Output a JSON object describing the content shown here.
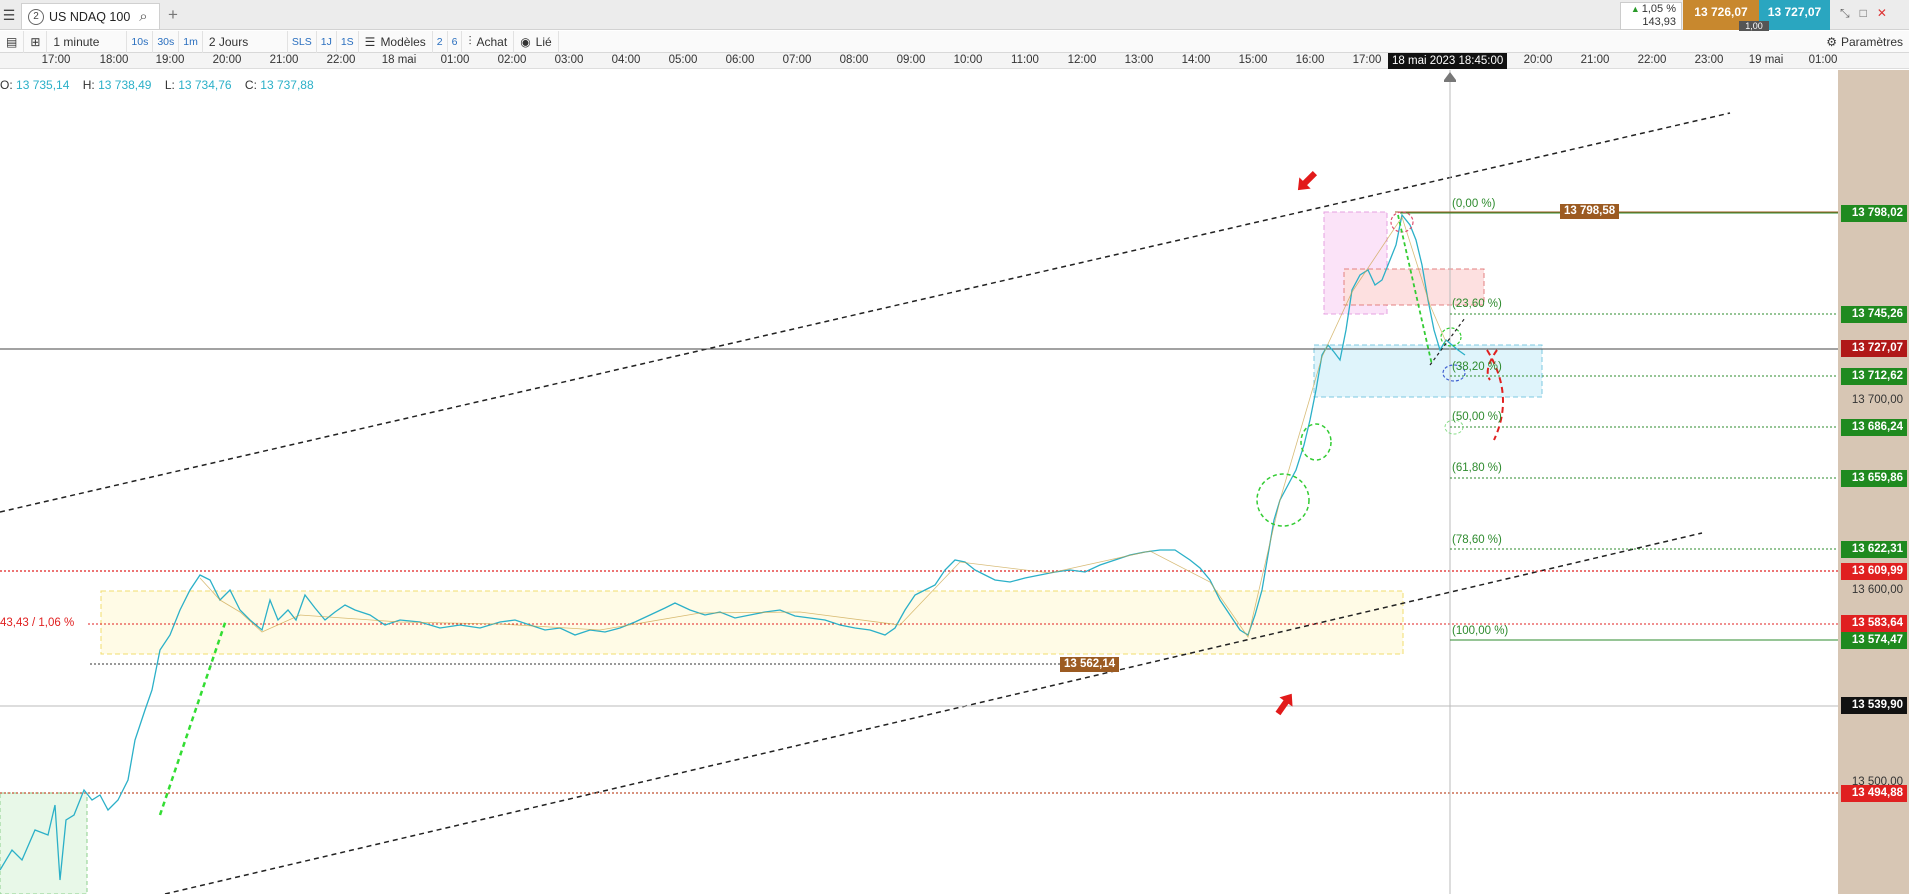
{
  "topbar": {
    "instrument_num": "2",
    "instrument_name": "US NDAQ 100",
    "change_pct": "1,05 %",
    "change_abs": "143,93",
    "bid": "13 726,07",
    "ask": "13 727,07",
    "spread": "1,00"
  },
  "toolbar": {
    "timeframe": "1 minute",
    "quick_frames": [
      "10s",
      "30s",
      "1m"
    ],
    "period": "2 Jours",
    "quick_flags": [
      "SLS",
      "1J",
      "1S"
    ],
    "models_label": "Modèles",
    "model_nums": [
      "2",
      "6"
    ],
    "buy_label": "Achat",
    "linked_label": "Lié",
    "settings_label": "Paramètres"
  },
  "time_axis": {
    "labels": [
      "17:00",
      "18:00",
      "19:00",
      "20:00",
      "21:00",
      "22:00",
      "18 mai",
      "01:00",
      "02:00",
      "03:00",
      "04:00",
      "05:00",
      "06:00",
      "07:00",
      "08:00",
      "09:00",
      "10:00",
      "11:00",
      "12:00",
      "13:00",
      "14:00",
      "15:00",
      "16:00",
      "17:00",
      "20:00",
      "21:00",
      "22:00",
      "23:00",
      "19 mai",
      "01:00"
    ],
    "crosshair_label": "18 mai 2023 18:45:00"
  },
  "ohlc": {
    "o_label": "O:",
    "o": "13 735,14",
    "h_label": "H:",
    "h": "13 738,49",
    "l_label": "L:",
    "l": "13 734,76",
    "c_label": "C:",
    "c": "13 737,88"
  },
  "price_labels": {
    "p1": "13 798,02",
    "p2": "13 745,26",
    "current": "13 727,07",
    "p3": "13 712,62",
    "p4": "13 686,24",
    "p5": "13 659,86",
    "p6": "13 622,31",
    "red1": "13 609,99",
    "red2": "13 583,64",
    "p7": "13 574,47",
    "crosshair_price": "13 539,90",
    "red3": "13 494,88"
  },
  "price_scale_ticks": [
    "13 700,00",
    "13 600,00",
    "13 500,00"
  ],
  "fib_levels": [
    "(0,00 %)",
    "(23,60 %)",
    "(38,20 %)",
    "(50,00 %)",
    "(61,80 %)",
    "(78,60 %)",
    "(100,00 %)"
  ],
  "annotations": {
    "top_flag": "13 798,58",
    "bottom_flag": "13 562,14",
    "range_note": "43,43 / 1,06 %"
  },
  "colors": {
    "bid": "#c8882e",
    "ask": "#2aa6c0",
    "fib_green": "#1f8a1f",
    "support_red": "#e02020",
    "price_line": "#2bb0c8",
    "flag_brown": "#9c5b22"
  }
}
